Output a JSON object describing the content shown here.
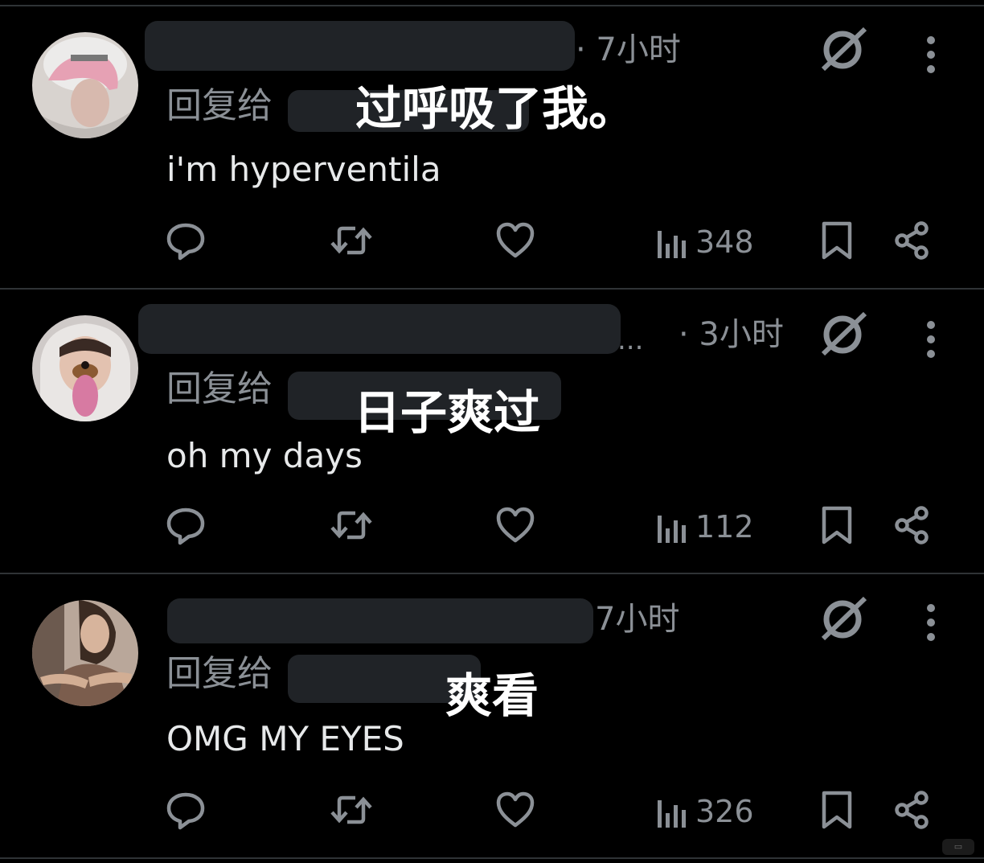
{
  "posts": [
    {
      "time": "· 7小时",
      "reply_label": "回复给",
      "overlay_text": "过呼吸了我。",
      "body": "i'm hyperventila",
      "views": "348",
      "avatar_colors": {
        "bg": "#d8d3cf",
        "hair": "#e6a1b4",
        "hood": "#bfbab6"
      }
    },
    {
      "time": "· 3小时",
      "ellipsis": "...",
      "reply_label": "回复给",
      "overlay_text": "日子爽过",
      "body": "oh my days",
      "views": "112",
      "avatar_colors": {
        "bg": "#cfcac8",
        "hair": "#3a2a24",
        "hood": "#e9e6e4"
      }
    },
    {
      "time": "7小时",
      "reply_label": "回复给",
      "overlay_text": "爽看",
      "body": "OMG MY EYES",
      "views": "326",
      "avatar_colors": {
        "bg": "#b9a79a",
        "hair": "#3b2b22",
        "hood": "#7b5d4d"
      }
    }
  ],
  "icons": {
    "grok": "grok-icon",
    "more": "more-vertical-icon",
    "reply": "reply-icon",
    "retweet": "retweet-icon",
    "like": "like-icon",
    "views": "views-icon",
    "bookmark": "bookmark-icon",
    "share": "share-icon"
  },
  "colors": {
    "background": "#000000",
    "muted": "#8b9096",
    "text": "#e7e9ea",
    "divider": "#2f3336"
  }
}
